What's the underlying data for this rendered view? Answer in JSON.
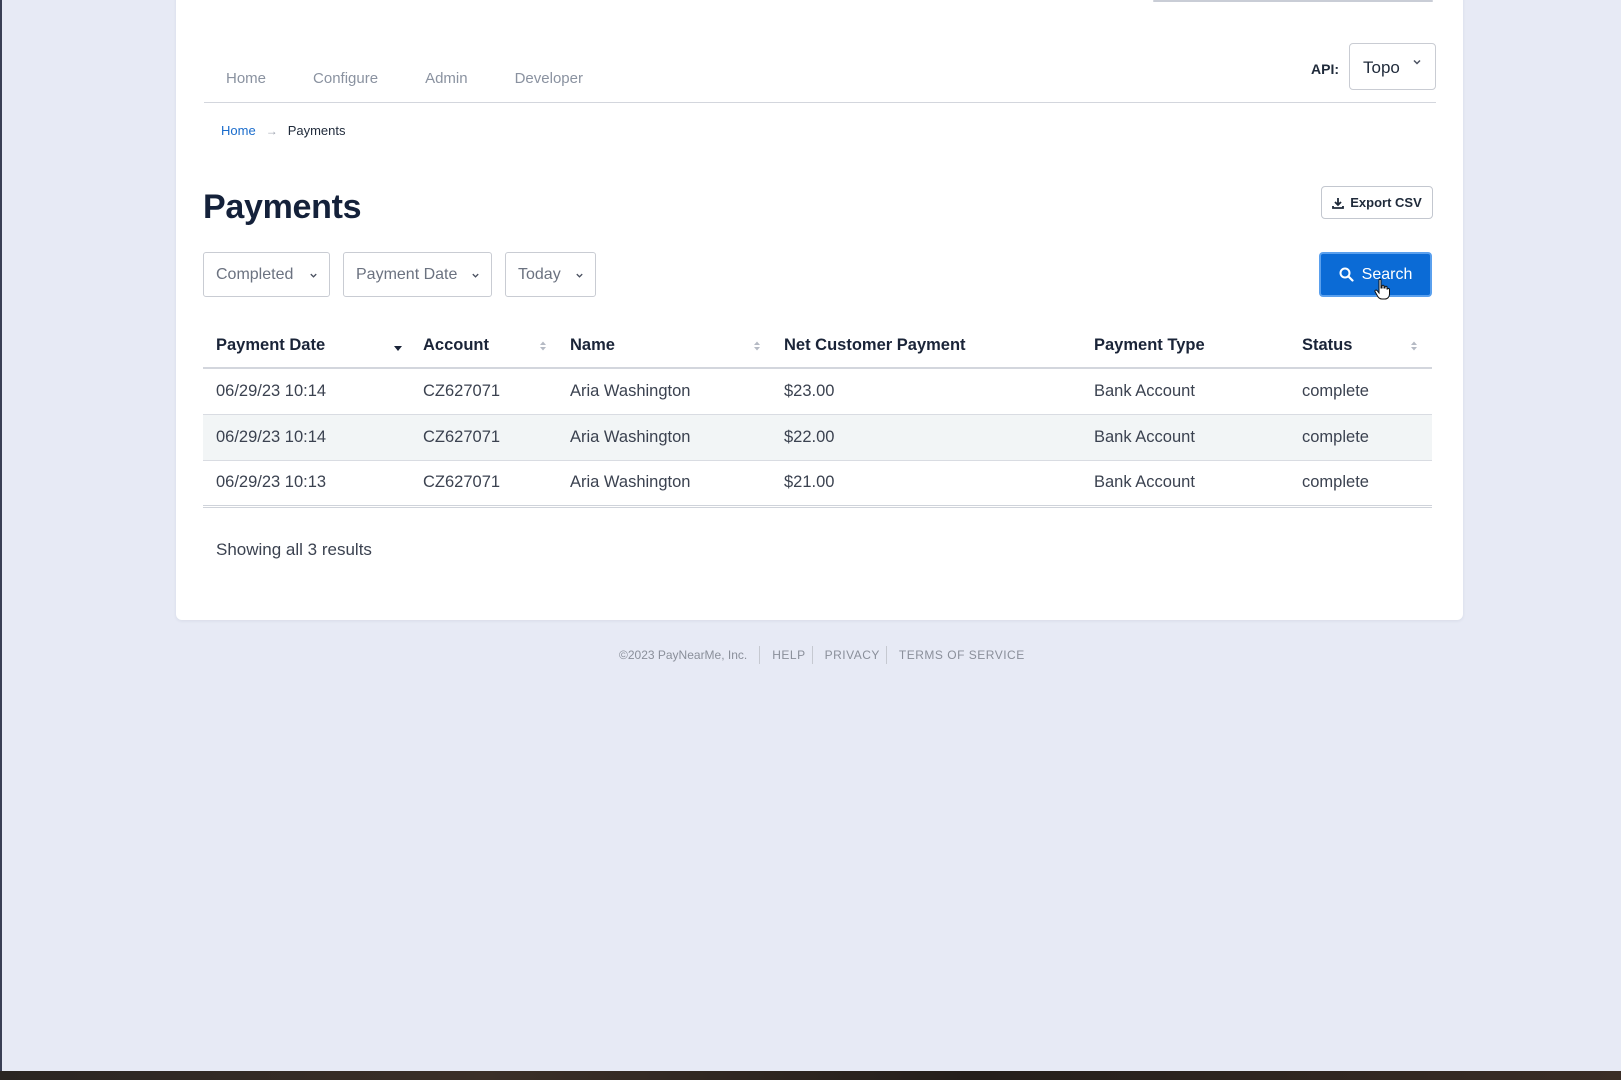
{
  "nav": {
    "tabs": [
      "Home",
      "Configure",
      "Admin",
      "Developer"
    ],
    "api_label": "API:",
    "api_value": "Topo"
  },
  "breadcrumb": {
    "home": "Home",
    "arrow": "→",
    "current": "Payments"
  },
  "page": {
    "title": "Payments",
    "export_label": "Export CSV"
  },
  "filters": {
    "status": "Completed",
    "date_field": "Payment Date",
    "range": "Today"
  },
  "search_label": "Search",
  "table": {
    "headers": [
      "Payment Date",
      "Account",
      "Name",
      "Net Customer Payment",
      "Payment Type",
      "Status"
    ],
    "rows": [
      [
        "06/29/23 10:14",
        "CZ627071",
        "Aria Washington",
        "$23.00",
        "Bank Account",
        "complete"
      ],
      [
        "06/29/23 10:14",
        "CZ627071",
        "Aria Washington",
        "$22.00",
        "Bank Account",
        "complete"
      ],
      [
        "06/29/23 10:13",
        "CZ627071",
        "Aria Washington",
        "$21.00",
        "Bank Account",
        "complete"
      ]
    ]
  },
  "results_text": "Showing all 3 results",
  "footer": {
    "copyright": "©2023 PayNearMe, Inc.",
    "links": [
      "HELP",
      "PRIVACY",
      "TERMS OF SERVICE"
    ]
  },
  "colors": {
    "accent": "#0b6bd6",
    "link": "#1a6ccc",
    "background": "#e7eaf5"
  }
}
